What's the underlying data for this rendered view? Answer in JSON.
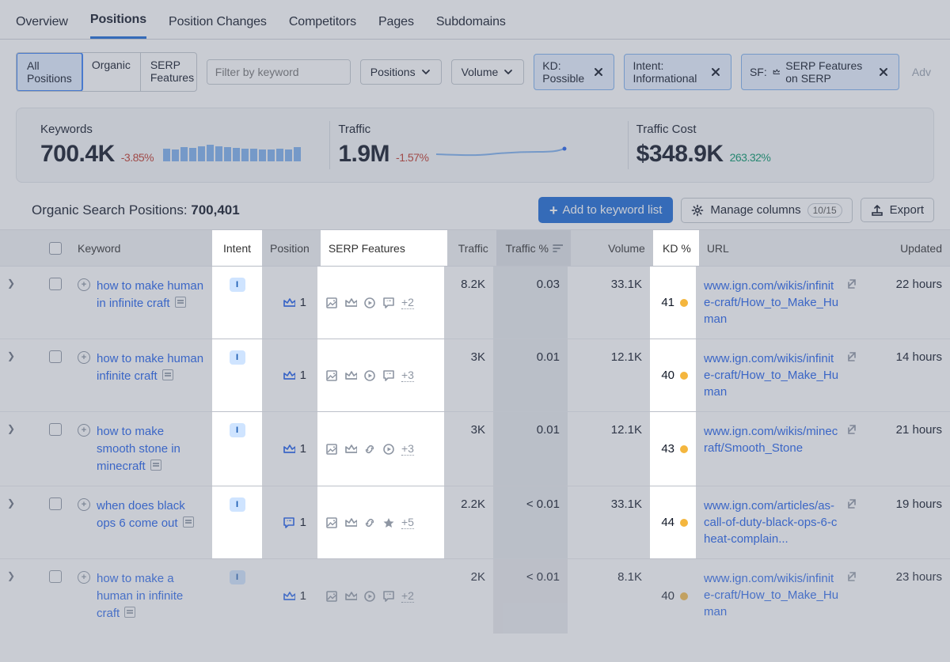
{
  "tabs": [
    "Overview",
    "Positions",
    "Position Changes",
    "Competitors",
    "Pages",
    "Subdomains"
  ],
  "active_tab": "Positions",
  "segments": {
    "all": "All Positions",
    "organic": "Organic",
    "serp": "SERP Features"
  },
  "filter_placeholder": "Filter by keyword",
  "dd_positions": "Positions",
  "dd_volume": "Volume",
  "chips": {
    "kd": "KD: Possible",
    "intent": "Intent: Informational",
    "sf": "SF:",
    "sf_val": "SERP Features on SERP"
  },
  "adv": "Adv",
  "stats": {
    "keywords": {
      "label": "Keywords",
      "value": "700.4K",
      "delta": "-3.85%",
      "delta_sign": "neg"
    },
    "traffic": {
      "label": "Traffic",
      "value": "1.9M",
      "delta": "-1.57%",
      "delta_sign": "neg"
    },
    "cost": {
      "label": "Traffic Cost",
      "value": "$348.9K",
      "delta": "263.32%",
      "delta_sign": "pos"
    }
  },
  "section": {
    "prefix": "Organic Search Positions: ",
    "count": "700,401"
  },
  "btn_add": "Add to keyword list",
  "btn_cols": "Manage columns",
  "cols_pill": "10/15",
  "btn_export": "Export",
  "headers": {
    "kw": "Keyword",
    "intent": "Intent",
    "pos": "Position",
    "sf": "SERP Features",
    "traf": "Traffic",
    "trafp": "Traffic %",
    "vol": "Volume",
    "kd": "KD %",
    "url": "URL",
    "upd": "Updated"
  },
  "rows": [
    {
      "kw": "how to make human in infinite craft",
      "intent": "I",
      "pos": "1",
      "pos_icon": "crown",
      "sf": [
        "image",
        "crown",
        "play",
        "speech"
      ],
      "sf_extra": "+2",
      "traf": "8.2K",
      "trafp": "0.03",
      "vol": "33.1K",
      "kd": "41",
      "url": "www.ign.com/wikis/infinite-craft/How_to_Make_Human",
      "upd": "22 hours"
    },
    {
      "kw": "how to make human infinite craft",
      "intent": "I",
      "pos": "1",
      "pos_icon": "crown",
      "sf": [
        "image",
        "crown",
        "play",
        "speech"
      ],
      "sf_extra": "+3",
      "traf": "3K",
      "trafp": "0.01",
      "vol": "12.1K",
      "kd": "40",
      "url": "www.ign.com/wikis/infinite-craft/How_to_Make_Human",
      "upd": "14 hours"
    },
    {
      "kw": "how to make smooth stone in minecraft",
      "intent": "I",
      "pos": "1",
      "pos_icon": "crown",
      "sf": [
        "image",
        "crown",
        "link",
        "play"
      ],
      "sf_extra": "+3",
      "traf": "3K",
      "trafp": "0.01",
      "vol": "12.1K",
      "kd": "43",
      "url": "www.ign.com/wikis/minecraft/Smooth_Stone",
      "upd": "21 hours"
    },
    {
      "kw": "when does black ops 6 come out",
      "intent": "I",
      "pos": "1",
      "pos_icon": "speech",
      "sf": [
        "image",
        "crown",
        "link",
        "star"
      ],
      "sf_extra": "+5",
      "traf": "2.2K",
      "trafp": "< 0.01",
      "vol": "33.1K",
      "kd": "44",
      "url": "www.ign.com/articles/as-call-of-duty-black-ops-6-cheat-complain...",
      "upd": "19 hours"
    },
    {
      "kw": "how to make a human in infinite craft",
      "intent": "I",
      "pos": "1",
      "pos_icon": "crown",
      "sf": [
        "image",
        "crown",
        "play",
        "speech"
      ],
      "sf_extra": "+2",
      "traf": "2K",
      "trafp": "< 0.01",
      "vol": "8.1K",
      "kd": "40",
      "url": "www.ign.com/wikis/infinite-craft/How_to_Make_Human",
      "upd": "23 hours"
    }
  ]
}
